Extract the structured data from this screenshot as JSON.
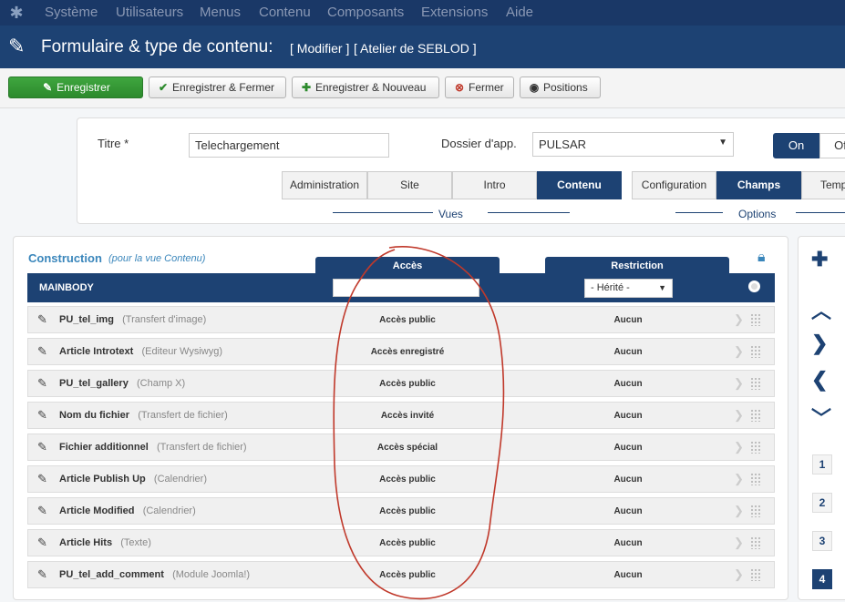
{
  "topmenu": [
    "Système",
    "Utilisateurs",
    "Menus",
    "Contenu",
    "Composants",
    "Extensions",
    "Aide"
  ],
  "header": {
    "title": "Formulaire & type de contenu:",
    "mode": "[ Modifier ]",
    "context": "[ Atelier de SEBLOD ]"
  },
  "toolbar": {
    "save": "Enregistrer",
    "save_close": "Enregistrer & Fermer",
    "save_new": "Enregistrer & Nouveau",
    "close": "Fermer",
    "positions": "Positions"
  },
  "form": {
    "title_label": "Titre",
    "title_required": "*",
    "title_value": "Telechargement",
    "folder_label": "Dossier d'app.",
    "folder_value": "PULSAR",
    "state_on": "On",
    "state_off": "Of",
    "views": [
      "Administration",
      "Site",
      "Intro",
      "Contenu"
    ],
    "views_caption": "Vues",
    "options": [
      "Configuration",
      "Champs",
      "Temp"
    ],
    "options_caption": "Options"
  },
  "construction": {
    "title": "Construction",
    "note": "(pour la vue Contenu)",
    "col_access": "Accès",
    "col_restriction": "Restriction",
    "position_name": "MAINBODY",
    "restriction_select": "- Hérité -",
    "rows": [
      {
        "name": "PU_tel_img",
        "type": "(Transfert d'image)",
        "access": "Accès public",
        "restriction": "Aucun"
      },
      {
        "name": "Article Introtext",
        "type": "(Editeur Wysiwyg)",
        "access": "Accès enregistré",
        "restriction": "Aucun"
      },
      {
        "name": "PU_tel_gallery",
        "type": "(Champ X)",
        "access": "Accès public",
        "restriction": "Aucun"
      },
      {
        "name": "Nom du fichier",
        "type": "(Transfert de fichier)",
        "access": "Accès invité",
        "restriction": "Aucun"
      },
      {
        "name": "Fichier additionnel",
        "type": "(Transfert de fichier)",
        "access": "Accès spécial",
        "restriction": "Aucun"
      },
      {
        "name": "Article Publish Up",
        "type": "(Calendrier)",
        "access": "Accès public",
        "restriction": "Aucun"
      },
      {
        "name": "Article Modified",
        "type": "(Calendrier)",
        "access": "Accès public",
        "restriction": "Aucun"
      },
      {
        "name": "Article Hits",
        "type": "(Texte)",
        "access": "Accès public",
        "restriction": "Aucun"
      },
      {
        "name": "PU_tel_add_comment",
        "type": "(Module Joomla!)",
        "access": "Accès public",
        "restriction": "Aucun"
      }
    ]
  },
  "sidebar_numbers": [
    "1",
    "2",
    "3",
    "4"
  ],
  "colors": {
    "navy": "#1d4273",
    "green": "#2c8a2c",
    "annotation_red": "#c0392b"
  }
}
